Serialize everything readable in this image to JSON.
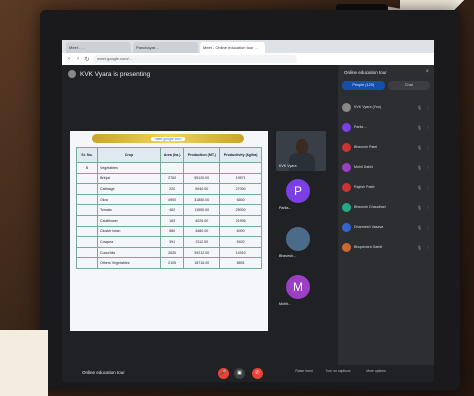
{
  "browser": {
    "tabs": [
      "Meet - ...",
      "Panchayat ...",
      "Meet - Online education tour ..."
    ],
    "url": "meet.google.com/..."
  },
  "meet": {
    "presenting_label": "KVK Vyara is presenting",
    "shared_pill": "meet.google.com",
    "self_tile_label": "KVK Vyara",
    "tiles": [
      {
        "initial": "P",
        "name": "Parita...",
        "color": "#7b3fe4"
      },
      {
        "initial": "",
        "name": "Bhavesh...",
        "color": "#4a6b8a"
      },
      {
        "initial": "M",
        "name": "Mohit...",
        "color": "#9b3fc4"
      }
    ],
    "meeting_name": "Online education tour",
    "bottom_labels": [
      "Raise hand",
      "Turn on captions",
      "More options"
    ]
  },
  "slide_table": {
    "headers": [
      "Sr. No.",
      "Crop",
      "Area (ha.)",
      "Production (MT.)",
      "Productivity (kg/ha)"
    ],
    "section": "Vegetables",
    "section_no": "B",
    "rows": [
      [
        "",
        "Brinjal",
        "2760",
        "55120.00",
        "19971"
      ],
      [
        "",
        "Cabbage",
        "220",
        "5940.00",
        "27000"
      ],
      [
        "",
        "Okra",
        "4900",
        "31850.00",
        "6500"
      ],
      [
        "",
        "Tomato",
        "462",
        "11550.00",
        "25000"
      ],
      [
        "",
        "Cauliflower",
        "183",
        "4025.00",
        "21995"
      ],
      [
        "",
        "Cluster bean",
        "580",
        "3480.00",
        "6000"
      ],
      [
        "",
        "Cowpea",
        "391",
        "2112.00",
        "5402"
      ],
      [
        "",
        "Cucurbits",
        "2630",
        "39212.00",
        "14910"
      ],
      [
        "",
        "Others Vegetables",
        "2105",
        "18716.00",
        "8891"
      ]
    ]
  },
  "side_panel": {
    "title": "Online education tour",
    "tabs": [
      "People (120)",
      "Chat"
    ],
    "participants": [
      {
        "name": "KVK Vyara (You)",
        "color": "#888"
      },
      {
        "name": "Parita ...",
        "color": "#7b3fe4"
      },
      {
        "name": "Bhavesh Patel",
        "color": "#c33"
      },
      {
        "name": "Mohit Dabhi",
        "color": "#9b3fc4"
      },
      {
        "name": "Rajesh Patel",
        "color": "#c33"
      },
      {
        "name": "Bhavesh Chaudhari",
        "color": "#2a8"
      },
      {
        "name": "Dharmesh Vasava",
        "color": "#36c"
      },
      {
        "name": "Bhupendra Gamit",
        "color": "#c63"
      }
    ]
  },
  "colors": {
    "accent": "#1a73e8",
    "end_call": "#ea4335",
    "pill": "#f2d45c"
  }
}
